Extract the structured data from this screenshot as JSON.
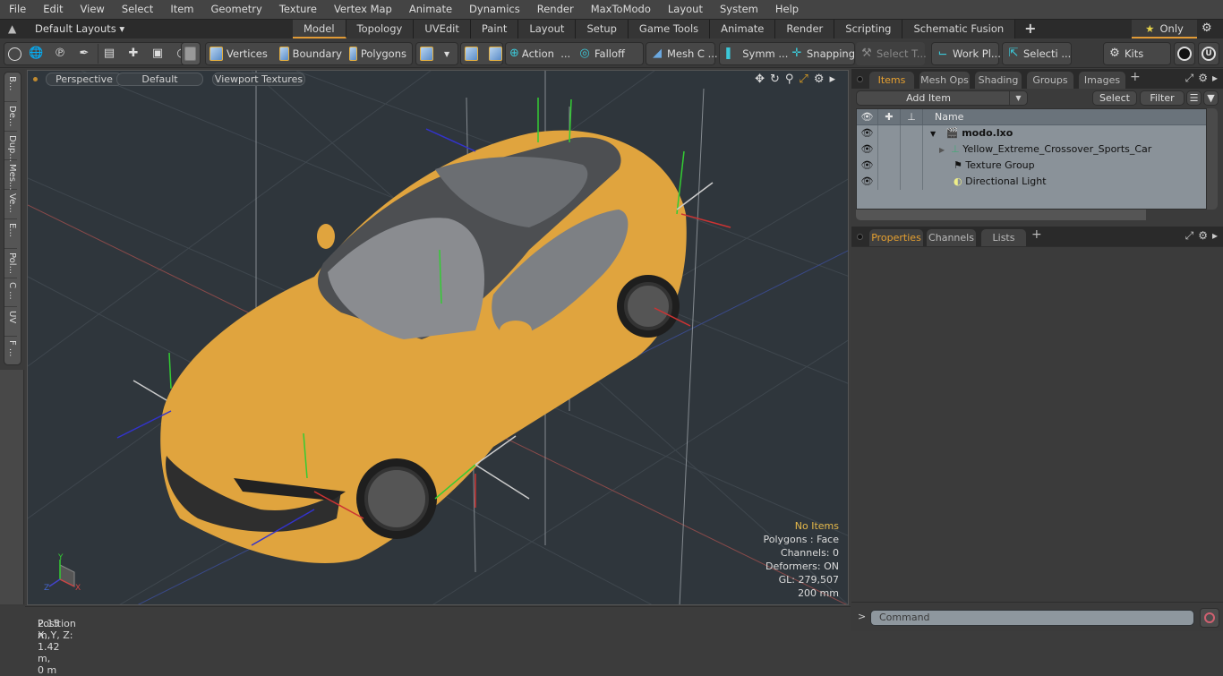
{
  "menu": [
    "File",
    "Edit",
    "View",
    "Select",
    "Item",
    "Geometry",
    "Texture",
    "Vertex Map",
    "Animate",
    "Dynamics",
    "Render",
    "MaxToModo",
    "Layout",
    "System",
    "Help"
  ],
  "layout_bar": {
    "layouts_label": "Default Layouts ▾",
    "tabs": [
      "Model",
      "Topology",
      "UVEdit",
      "Paint",
      "Layout",
      "Setup",
      "Game Tools",
      "Animate",
      "Render",
      "Scripting",
      "Schematic Fusion"
    ],
    "active_tab": "Model",
    "add_tab": "+",
    "only_label": "Only"
  },
  "toolbar": {
    "vertices": "Vertices",
    "boundary": "Boundary",
    "polygons": "Polygons",
    "action": "Action",
    "action_more": "...",
    "falloff": "Falloff",
    "mesh_c": "Mesh C ...",
    "symm": "Symm ...",
    "snapping": "Snapping",
    "select_t": "Select T...",
    "work_pl": "Work Pl...",
    "selecti": "Selecti ...",
    "kits": "Kits"
  },
  "left_tabs": [
    "B...",
    "De...",
    "Dup...",
    "Mes...",
    "Ve...",
    "E...",
    "Pol...",
    "C ...",
    "UV",
    "F ..."
  ],
  "viewport": {
    "view_mode": "Perspective",
    "shading": "Default",
    "textures": "Viewport Textures",
    "stats": {
      "selection": "No Items",
      "polygons": "Polygons : Face",
      "channels": "Channels: 0",
      "deformers": "Deformers: ON",
      "gl": "GL: 279,507",
      "scale": "200 mm"
    },
    "axis_labels": {
      "x": "X",
      "y": "Y",
      "z": "Z"
    }
  },
  "status": {
    "position_label": "Position X, Y, Z:",
    "position_value": "2.15 m, 1.42 m, 0 m"
  },
  "items_panel": {
    "tabs": [
      "Items",
      "Mesh Ops",
      "Shading",
      "Groups",
      "Images"
    ],
    "active_tab": "Items",
    "add_item": "Add Item",
    "select": "Select",
    "filter": "Filter",
    "column_name": "Name",
    "items": [
      {
        "name": "modo.lxo",
        "type": "scene",
        "bold": true
      },
      {
        "name": "Yellow_Extreme_Crossover_Sports_Car",
        "type": "locator"
      },
      {
        "name": "Texture Group",
        "type": "texture-group"
      },
      {
        "name": "Directional Light",
        "type": "light"
      }
    ]
  },
  "properties_panel": {
    "tabs": [
      "Properties",
      "Channels",
      "Lists"
    ],
    "active_tab": "Properties"
  },
  "command": {
    "placeholder": "Command",
    "prompt": ">"
  },
  "colors": {
    "accent": "#e09a36",
    "viewport_bg": "#2f363c",
    "car_body": "#e3a640"
  }
}
